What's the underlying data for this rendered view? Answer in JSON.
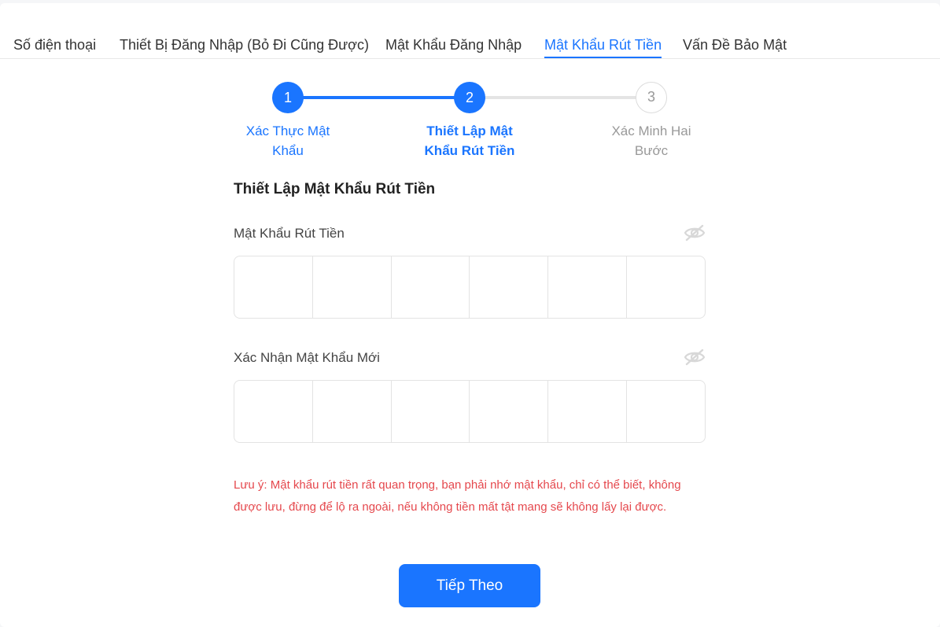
{
  "tabs": [
    {
      "label": "Số điện thoại",
      "active": false
    },
    {
      "label": "Thiết Bị Đăng Nhập (Bỏ Đi Cũng Được)",
      "active": false
    },
    {
      "label": "Mật Khẩu Đăng Nhập",
      "active": false
    },
    {
      "label": "Mật Khẩu Rút Tiền",
      "active": true
    },
    {
      "label": "Vấn Đề Bảo Mật",
      "active": false
    }
  ],
  "steps": [
    {
      "number": "1",
      "label_line1": "Xác Thực Mật",
      "label_line2": "Khẩu",
      "state": "done"
    },
    {
      "number": "2",
      "label_line1": "Thiết Lập Mật",
      "label_line2": "Khẩu Rút Tiền",
      "state": "current"
    },
    {
      "number": "3",
      "label_line1": "Xác Minh Hai",
      "label_line2": "Bước",
      "state": "todo"
    }
  ],
  "form": {
    "title": "Thiết Lập Mật Khẩu Rút Tiền",
    "password_label": "Mật Khẩu Rút Tiền",
    "confirm_label": "Xác Nhận Mật Khẩu Mới",
    "pin_length": 6,
    "note": "Lưu ý: Mật khẩu rút tiền rất quan trọng, bạn phải nhớ mật khẩu, chỉ có thể biết, không được lưu, đừng để lộ ra ngoài, nếu không tiền mất tật mang sẽ không lấy lại được.",
    "next_button": "Tiếp Theo"
  },
  "icons": {
    "visibility_toggle": "eye-off-icon"
  },
  "colors": {
    "accent": "#1a75ff",
    "warning": "#e5484d",
    "inactive": "#999999"
  }
}
